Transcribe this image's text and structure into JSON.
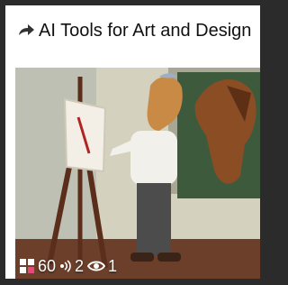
{
  "card": {
    "title": "AI Tools for Art and Design",
    "share_icon": "share-arrow-icon"
  },
  "stats": {
    "grid_count": "60",
    "audio_count": "2",
    "views_count": "1",
    "grid_icon": "grid-icon",
    "audio_icon": "audio-icon",
    "eye_icon": "eye-icon"
  }
}
